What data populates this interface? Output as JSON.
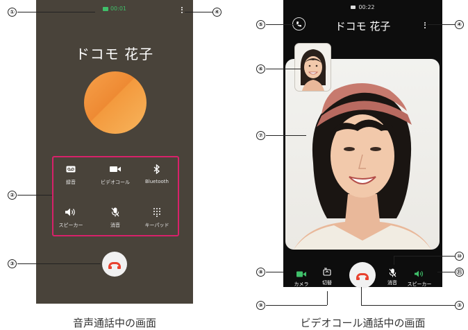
{
  "voice_call": {
    "status_time": "00:01",
    "caller_name": "ドコモ 花子",
    "buttons": [
      {
        "label": "録音",
        "icon": "voicemail-icon"
      },
      {
        "label": "ビデオコール",
        "icon": "videocam-icon"
      },
      {
        "label": "Bluetooth",
        "icon": "bluetooth-icon"
      },
      {
        "label": "スピーカー",
        "icon": "speaker-icon"
      },
      {
        "label": "消音",
        "icon": "mic-off-icon"
      },
      {
        "label": "キーパッド",
        "icon": "dialpad-icon"
      }
    ],
    "caption": "音声通話中の画面"
  },
  "video_call": {
    "status_time": "00:22",
    "caller_name": "ドコモ 花子",
    "buttons": [
      {
        "label": "カメラ",
        "icon": "camera-icon",
        "color": "#3fc06a"
      },
      {
        "label": "切替",
        "icon": "switch-camera-icon"
      },
      {
        "label": "消音",
        "icon": "mic-off-icon"
      },
      {
        "label": "スピーカー",
        "icon": "speaker-icon",
        "color": "#3fc06a"
      }
    ],
    "caption": "ビデオコール通話中の画面"
  },
  "callouts": [
    "①",
    "②",
    "③",
    "④",
    "⑤",
    "⑥",
    "⑦",
    "⑧",
    "⑨",
    "⑩",
    "⑪"
  ],
  "colors": {
    "accent": "#3fc06a",
    "end_call": "#e8412e",
    "highlight_box": "#d8216a"
  }
}
